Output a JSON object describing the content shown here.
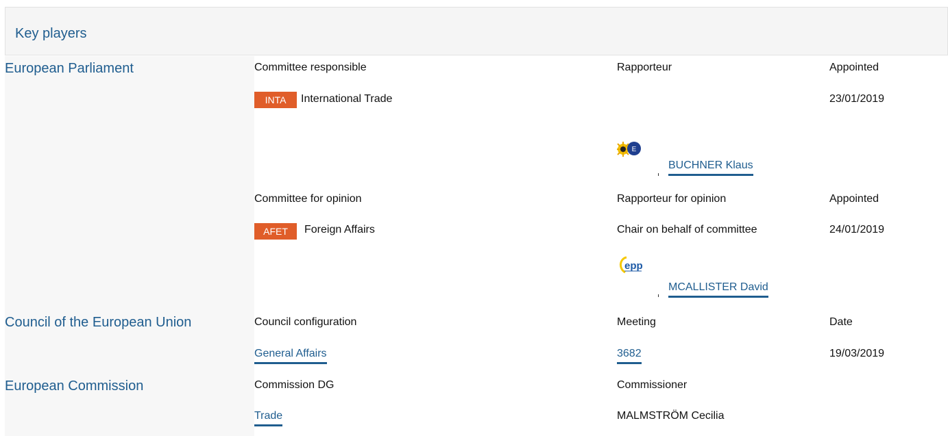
{
  "header": {
    "title": "Key players"
  },
  "european_parliament": {
    "title": "European Parliament",
    "responsible": {
      "col_committee": "Committee responsible",
      "col_rapporteur": "Rapporteur",
      "col_appointed": "Appointed",
      "committee_code": "INTA",
      "committee_name": "International Trade",
      "appointed_date": "23/01/2019",
      "rapporteur_name": "BUCHNER Klaus",
      "rapporteur_group_icon": "greens-efa-logo"
    },
    "opinion": {
      "col_committee": "Committee for opinion",
      "col_rapporteur": "Rapporteur for opinion",
      "col_appointed": "Appointed",
      "committee_code": "AFET",
      "committee_name": "Foreign Affairs",
      "rapporteur_role": "Chair on behalf of committee",
      "appointed_date": "24/01/2019",
      "rapporteur_name": "MCALLISTER David",
      "rapporteur_group_icon": "epp-logo",
      "epp_logo_text": "epp"
    }
  },
  "council": {
    "title": "Council of the European Union",
    "col_configuration": "Council configuration",
    "col_meeting": "Meeting",
    "col_date": "Date",
    "configuration": "General Affairs",
    "meeting": "3682",
    "date": "19/03/2019"
  },
  "commission": {
    "title": "European Commission",
    "col_dg": "Commission DG",
    "col_commissioner": "Commissioner",
    "dg": "Trade",
    "commissioner": "MALMSTRÖM Cecilia"
  },
  "colors": {
    "link": "#1f5d8f",
    "badge": "#e05d29",
    "header_bg": "#f5f5f5"
  }
}
